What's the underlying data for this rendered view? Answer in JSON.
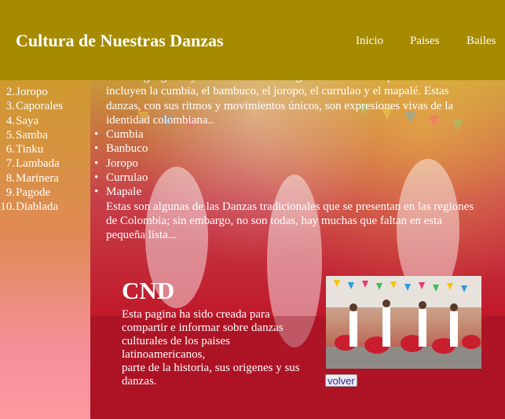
{
  "header": {
    "title": "Cultura de Nuestras Danzas",
    "nav": [
      "Inicio",
      "Paises",
      "Bailes"
    ]
  },
  "sidebar": {
    "items": [
      {
        "num": "2.",
        "label": "Joropo"
      },
      {
        "num": "3.",
        "label": "Caporales"
      },
      {
        "num": "4.",
        "label": "Saya"
      },
      {
        "num": "5.",
        "label": "Samba"
      },
      {
        "num": "6.",
        "label": "Tinku"
      },
      {
        "num": "7.",
        "label": "Lambada"
      },
      {
        "num": "8.",
        "label": "Marinera"
      },
      {
        "num": "9.",
        "label": "Pagode"
      },
      {
        "num": "10.",
        "label": "Diablada"
      }
    ]
  },
  "main": {
    "intro": "variada geografía y herencia cultural. Algunas de las más representativas incluyen la cumbia, el bambuco, el joropo, el currulao y el mapalé. Estas danzas, con sus ritmos y movimientos únicos, son expresiones vivas de la identidad colombiana..",
    "dances": [
      "Cumbia",
      "Banbuco",
      "Joropo",
      "Currulao",
      "Mapale"
    ],
    "outro": "Estas son algunas de las Danzas tradicionales que se presentan en las regiones de Colombia; sin embargo, no son todas, hay muchas que faltan en esta pequeña lista..."
  },
  "cnd": {
    "title": "CND",
    "text": "Esta pagina ha sido creada para compartir e informar sobre danzas culturales de los paises latinoamericanos,",
    "text2": "parte de la historia, sus origenes y sus danzas."
  },
  "back_button": "volver"
}
